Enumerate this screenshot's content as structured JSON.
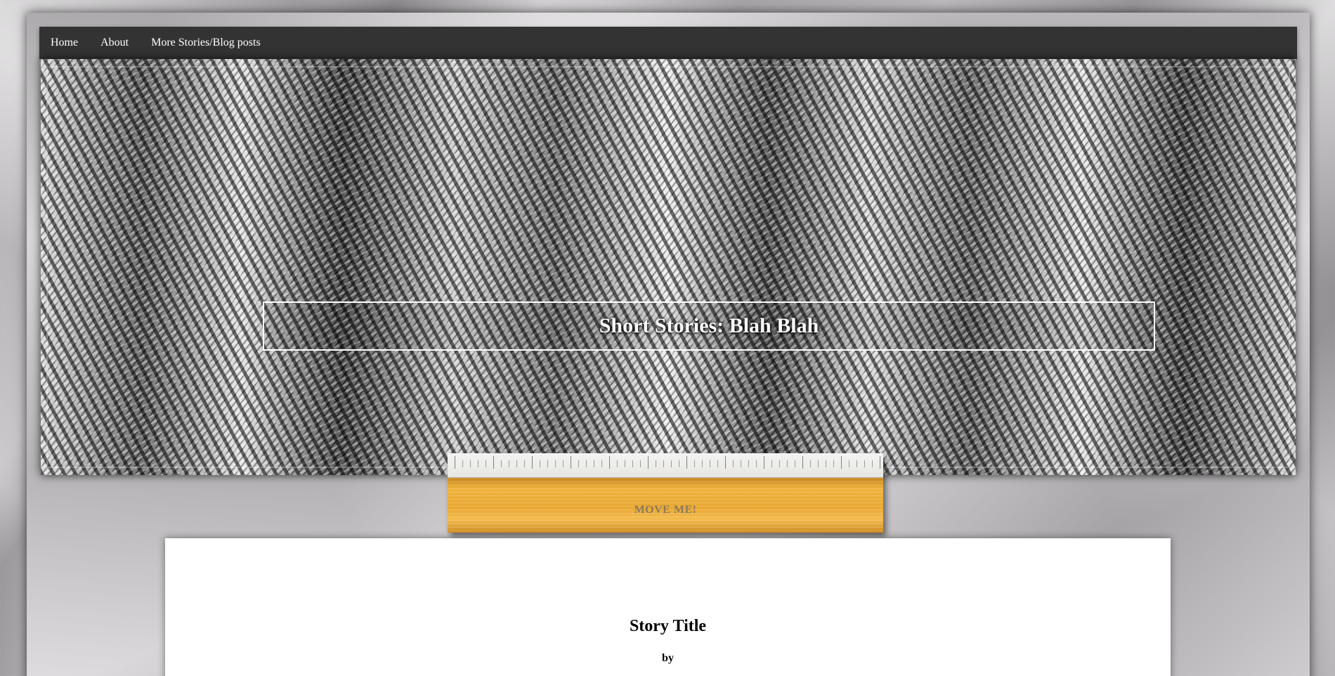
{
  "nav": {
    "items": [
      {
        "label": "Home"
      },
      {
        "label": "About"
      },
      {
        "label": "More Stories/Blog posts"
      }
    ]
  },
  "header": {
    "site_title": "Short Stories: Blah Blah"
  },
  "ruler": {
    "label": "MOVE ME!"
  },
  "story": {
    "title": "Story Title",
    "byline": "by"
  },
  "colors": {
    "navbar_bg": "#333333",
    "nav_text": "#ffffff",
    "ruler_wood": "#e8a732",
    "card_bg": "#ffffff"
  }
}
